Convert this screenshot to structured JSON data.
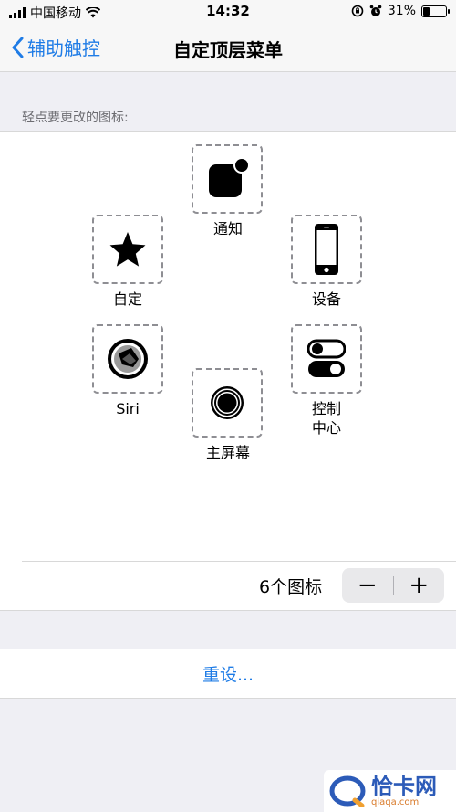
{
  "status_bar": {
    "carrier": "中国移动",
    "time": "14:32",
    "battery": "31%",
    "battery_level": 0.31
  },
  "nav": {
    "back_label": "辅助触控",
    "title": "自定顶层菜单"
  },
  "section_header": "轻点要更改的图标:",
  "icons": {
    "notification": {
      "label": "通知",
      "icon": "notification-icon"
    },
    "custom": {
      "label": "自定",
      "icon": "star-icon"
    },
    "device": {
      "label": "设备",
      "icon": "iphone-icon"
    },
    "siri": {
      "label": "Siri",
      "icon": "siri-icon"
    },
    "control_center": {
      "label": "控制\n中心",
      "icon": "toggles-icon"
    },
    "home": {
      "label": "主屏幕",
      "icon": "home-button-icon"
    }
  },
  "icon_count": "6个图标",
  "stepper": {
    "minus": "−",
    "plus": "+"
  },
  "reset_label": "重设...",
  "watermark": {
    "name": "恰卡网",
    "url": "qiaqa.com"
  },
  "colors": {
    "accent": "#1f7ce6",
    "background": "#efeff4"
  }
}
